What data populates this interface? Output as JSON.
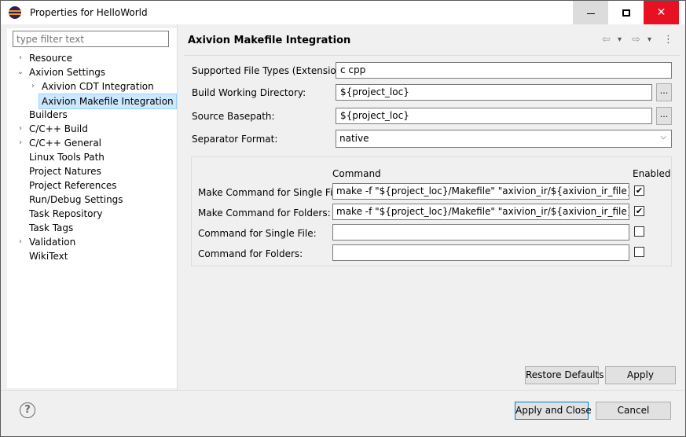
{
  "window": {
    "title": "Properties for HelloWorld",
    "minimize_icon": "minimize-icon",
    "maximize_icon": "maximize-icon",
    "close_icon": "close-icon",
    "close_glyph": "✕"
  },
  "sidebar": {
    "filter_placeholder": "type filter text",
    "items": [
      {
        "label": "Resource",
        "expand": "›"
      },
      {
        "label": "Axivion Settings",
        "expand": "⌄"
      },
      {
        "label": "Axivion CDT Integration",
        "expand": "›"
      },
      {
        "label": "Axivion Makefile Integration"
      },
      {
        "label": "Builders"
      },
      {
        "label": "C/C++ Build",
        "expand": "›"
      },
      {
        "label": "C/C++ General",
        "expand": "›"
      },
      {
        "label": "Linux Tools Path"
      },
      {
        "label": "Project Natures"
      },
      {
        "label": "Project References"
      },
      {
        "label": "Run/Debug Settings"
      },
      {
        "label": "Task Repository"
      },
      {
        "label": "Task Tags"
      },
      {
        "label": "Validation",
        "expand": "›"
      },
      {
        "label": "WikiText"
      }
    ]
  },
  "main": {
    "title": "Axivion Makefile Integration",
    "nav": {
      "back": "⇦",
      "back_menu": "▾",
      "forward": "⇨",
      "forward_menu": "▾",
      "more": "⋮"
    },
    "fields": {
      "file_types_label": "Supported File Types (Extensions):",
      "file_types_value": "c cpp",
      "build_dir_label": "Build Working Directory:",
      "build_dir_value": "${project_loc}",
      "basepath_label": "Source Basepath:",
      "basepath_value": "${project_loc}",
      "separator_label": "Separator Format:",
      "separator_value": "native",
      "browse_label": "..."
    },
    "commands": {
      "command_header": "Command",
      "enabled_header": "Enabled",
      "check_glyph": "✔",
      "rows": [
        {
          "label": "Make Command for Single File:",
          "value": "make -f \"${project_loc}/Makefile\" \"axivion_ir/${axivion_ir_file}.o.ir\"",
          "enabled": true
        },
        {
          "label": "Make Command for Folders:",
          "value": "make -f \"${project_loc}/Makefile\" \"axivion_ir/${axivion_ir_file}.ir\"",
          "enabled": true
        },
        {
          "label": "Command for Single File:",
          "value": "",
          "enabled": false
        },
        {
          "label": "Command for Folders:",
          "value": "",
          "enabled": false
        }
      ]
    },
    "restore_defaults": "Restore Defaults",
    "apply": "Apply"
  },
  "footer": {
    "help_glyph": "?",
    "apply_and_close": "Apply and Close",
    "cancel": "Cancel"
  }
}
